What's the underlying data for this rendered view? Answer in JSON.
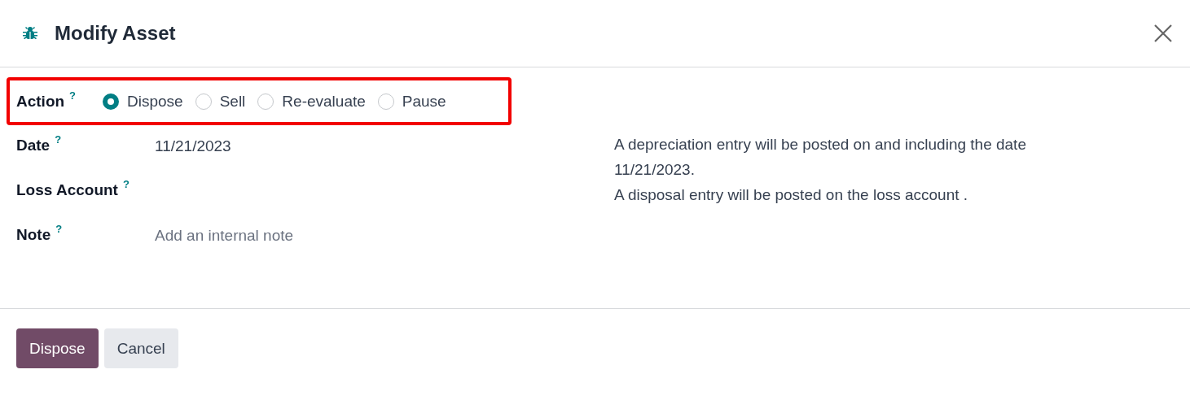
{
  "dialog": {
    "title": "Modify Asset"
  },
  "action": {
    "label": "Action",
    "help": "?",
    "highlighted": true,
    "options": [
      {
        "label": "Dispose",
        "selected": true
      },
      {
        "label": "Sell",
        "selected": false
      },
      {
        "label": "Re-evaluate",
        "selected": false
      },
      {
        "label": "Pause",
        "selected": false
      }
    ]
  },
  "fields": [
    {
      "label": "Date",
      "help": "?",
      "value": "11/21/2023"
    },
    {
      "label": "Loss Account",
      "help": "?"
    },
    {
      "label": "Note",
      "help": "?",
      "placeholder": "Add an internal note"
    }
  ],
  "summary": [
    "A depreciation entry will be posted on and including the date 11/21/2023.",
    "A disposal entry will be posted on the loss account ."
  ],
  "buttons": [
    {
      "label": "Dispose",
      "kind": "primary"
    },
    {
      "label": "Cancel",
      "kind": "secondary"
    }
  ]
}
